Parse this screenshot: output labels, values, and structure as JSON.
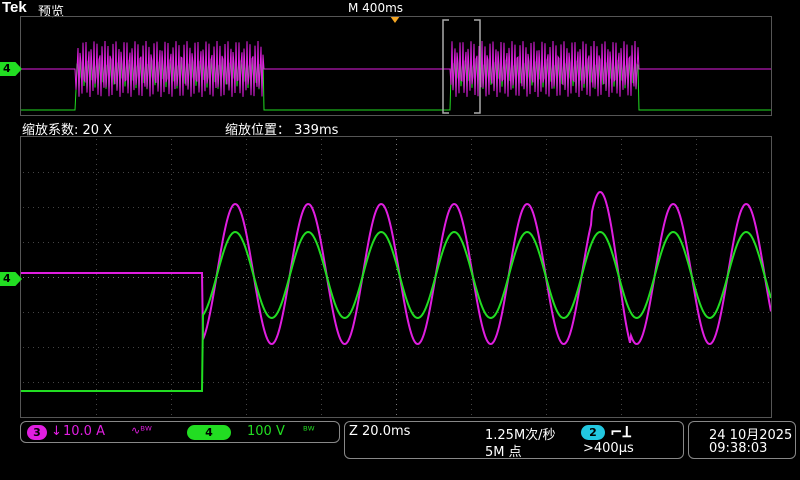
{
  "header": {
    "brand": "Tek",
    "mode": "预览",
    "timebase": "M 400ms"
  },
  "zoom": {
    "factor_label": "缩放系数: 20 X",
    "position_label": "缩放位置： 339ms"
  },
  "channels": {
    "ch3": {
      "number": "3",
      "coupling_symbol": "↓",
      "scale": "10.0 A",
      "extra": "∿ᴮᵂ",
      "color": "#e01ee0"
    },
    "ch4": {
      "number": "4",
      "scale": "100 V",
      "extra": "ᴮᵂ",
      "color": "#22dd22"
    }
  },
  "marker": {
    "ch4": "4"
  },
  "acquisition": {
    "zoom_scale": "Z 20.0ms",
    "sample_rate": "1.25M次/秒",
    "record_length": "5M 点",
    "trigger_source": "2",
    "trigger_symbol": "⌐Ʇ",
    "trigger_level": ">400μs"
  },
  "datetime": {
    "date": "24 10月2025",
    "time": "09:38:03"
  },
  "colors": {
    "accent": "#f5a623",
    "ch3": "#e01ee0",
    "ch4": "#22dd22",
    "trigger_badge": "#22c7e0"
  }
}
